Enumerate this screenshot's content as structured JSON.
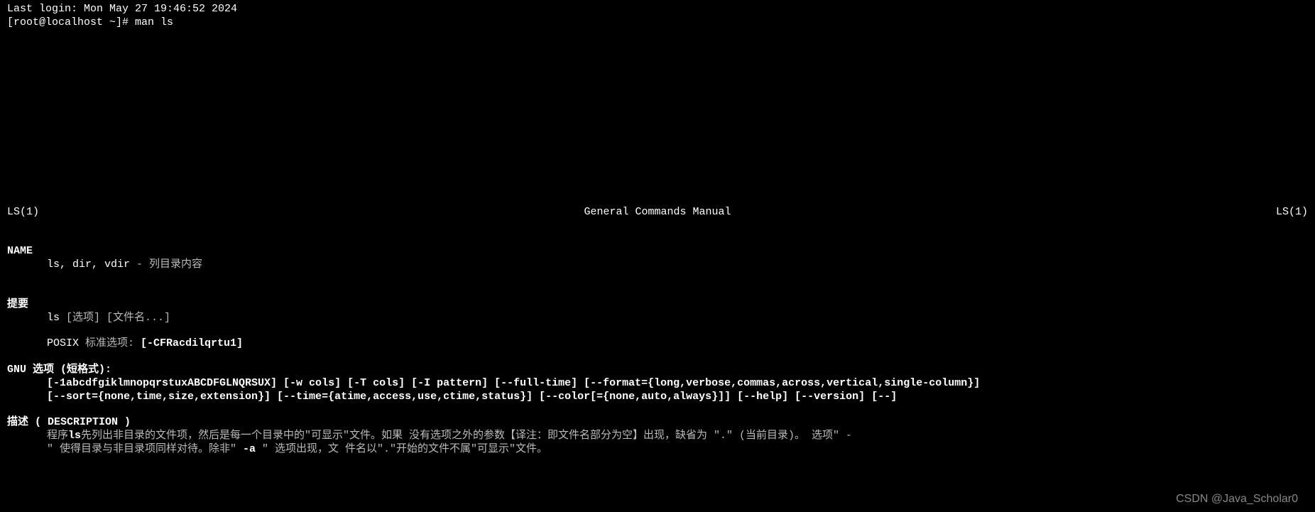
{
  "login_line": "Last login: Mon May 27 19:46:52 2024",
  "prompt": "[root@localhost ~]# ",
  "command": "man ls",
  "man_header": {
    "left": "LS(1)",
    "center": "General Commands Manual",
    "right": "LS(1)"
  },
  "name_section": {
    "header": "NAME",
    "commands": "ls, dir, vdir",
    "separator": " - ",
    "description": "列目录内容"
  },
  "synopsis_section": {
    "header": "提要",
    "line1_cmd": "ls",
    "line1_args": " [选项] [文件名...]",
    "line2_prefix": "POSIX ",
    "line2_label": "标准选项: ",
    "line2_opts": "[-CFRacdilqrtu1]"
  },
  "gnu_section": {
    "header_prefix": "GNU ",
    "header_text": "选项 (短格式):",
    "line1": "[-1abcdfgiklmnopqrstuxABCDFGLNQRSUX]   [-w   cols]   [-T   cols]   [-I   pattern]   [--full-time]   [--format={long,verbose,commas,across,vertical,single-column}]",
    "line2": "[--sort={none,time,size,extension}] [--time={atime,access,use,ctime,status}] [--color[={none,auto,always}]] [--help] [--version] [--]"
  },
  "description_section": {
    "header": "描述 ( DESCRIPTION )",
    "line1_p1": "程序",
    "line1_bold1": "ls",
    "line1_p2": "先列出非目录的文件项，然后是每一个目录中的\"可显示\"文件。如果   没有选项之外的参数【译注：即文件名部分为空】出现，缺省为  \".\"   (当前目录)。    选项\"   -",
    "line2_p1": "\" 使得目录与非目录项同样对待。除非\"   ",
    "line2_bold": "-a",
    "line2_p2": " \"   选项出现，文 件名以\".\"开始的文件不属\"可显示\"文件。"
  },
  "watermark": "CSDN @Java_Scholar0"
}
